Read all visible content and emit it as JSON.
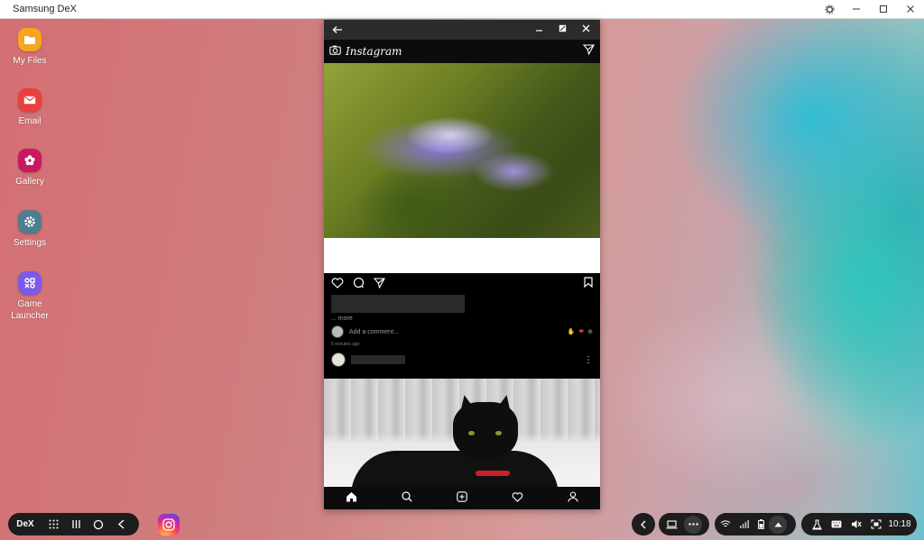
{
  "titlebar": {
    "title": "Samsung DeX"
  },
  "desktop": {
    "icons": [
      {
        "label": "My Files",
        "icon": "folder-icon",
        "color": "#f5a623"
      },
      {
        "label": "Email",
        "icon": "envelope-icon",
        "color": "#e8403f"
      },
      {
        "label": "Gallery",
        "icon": "flower-icon",
        "color": "#c9185f"
      },
      {
        "label": "Settings",
        "icon": "gear-icon",
        "color": "#4f7d91"
      },
      {
        "label": "Game Launcher",
        "icon": "game-icon",
        "color": "#7b5be6"
      }
    ]
  },
  "app": {
    "logo": "Instagram",
    "post1": {
      "more": "... more",
      "comment_placeholder": "Add a comment...",
      "time": "6 minutes ago"
    }
  },
  "taskbar": {
    "dex_label": "DeX",
    "clock": "10:18"
  },
  "colors": {
    "accent_red": "#e8403f",
    "dark_bar": "#1d1d1d"
  }
}
